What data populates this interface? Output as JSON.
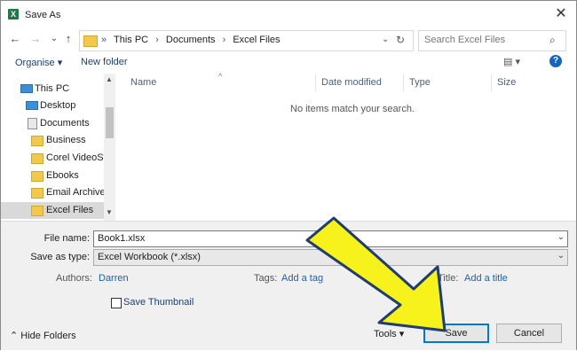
{
  "window": {
    "title": "Save As",
    "app_icon_letter": "X",
    "close_glyph": "✕"
  },
  "nav": {
    "back": "←",
    "forward": "→",
    "recent": "⌄",
    "up": "↑",
    "breadcrumb_lead": "»",
    "breadcrumbs": [
      "This PC",
      "Documents",
      "Excel Files"
    ],
    "crumb_sep": "›",
    "dropdown": "⌄",
    "refresh": "↻",
    "search_placeholder": "Search Excel Files",
    "search_glyph": "⌕"
  },
  "toolbar": {
    "organise": "Organise ▾",
    "new_folder": "New folder",
    "view": "▤ ▾",
    "help": "?"
  },
  "sidebar": {
    "items": [
      {
        "label": "This PC",
        "icon": "pc-icon"
      },
      {
        "label": "Desktop",
        "icon": "desktop-icon"
      },
      {
        "label": "Documents",
        "icon": "documents-icon"
      },
      {
        "label": "Business",
        "icon": "folder-icon"
      },
      {
        "label": "Corel VideoStu",
        "icon": "folder-icon"
      },
      {
        "label": "Ebooks",
        "icon": "folder-icon"
      },
      {
        "label": "Email Archive",
        "icon": "folder-icon"
      },
      {
        "label": "Excel Files",
        "icon": "folder-icon",
        "selected": true
      }
    ],
    "scroll_up": "▲",
    "scroll_down": "▼"
  },
  "columns": {
    "name": "Name",
    "date_modified": "Date modified",
    "type": "Type",
    "size": "Size",
    "sort_caret": "^"
  },
  "empty_message": "No items match your search.",
  "form": {
    "file_name_label": "File name:",
    "file_name_value": "Book1.xlsx",
    "save_as_type_label": "Save as type:",
    "save_as_type_value": "Excel Workbook (*.xlsx)",
    "dropdown_glyph": "⌄",
    "authors_label": "Authors:",
    "authors_value": "Darren",
    "tags_label": "Tags:",
    "tags_value": "Add a tag",
    "title_label": "Title:",
    "title_value": "Add a title",
    "save_thumbnail": "Save Thumbnail"
  },
  "footer": {
    "hide_folders": "⌃ Hide Folders",
    "tools": "Tools ▾",
    "save": "Save",
    "cancel": "Cancel"
  },
  "colors": {
    "arrow_fill": "#f7f21c",
    "arrow_stroke": "#1f3d6e",
    "link": "#1f5fa8",
    "folder": "#f0c94d"
  }
}
